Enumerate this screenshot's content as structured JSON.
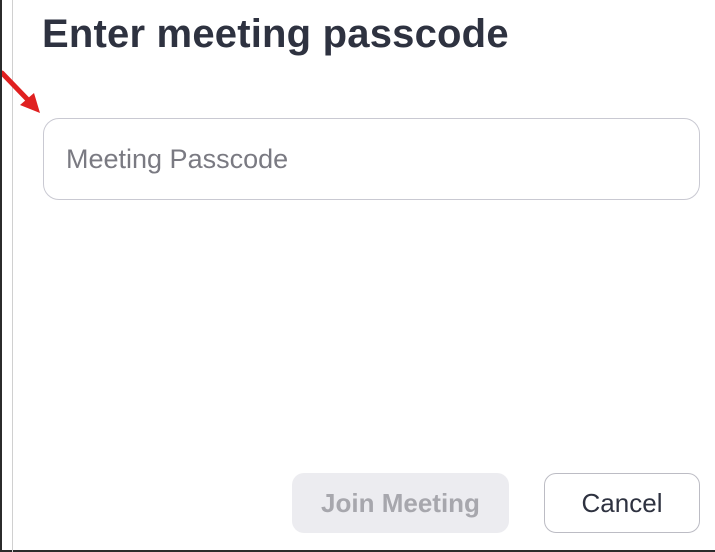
{
  "dialog": {
    "title": "Enter meeting passcode",
    "passcode_input": {
      "placeholder": "Meeting Passcode",
      "value": ""
    },
    "buttons": {
      "join_label": "Join Meeting",
      "join_enabled": false,
      "cancel_label": "Cancel"
    }
  },
  "annotation": {
    "arrow_color": "#e02020",
    "arrow_icon": "red-pointer-arrow-icon"
  },
  "colors": {
    "title_text": "#2e3240",
    "input_border": "#c9c9d2",
    "disabled_button_bg": "#ececf0",
    "disabled_button_text": "#a7a7ad"
  }
}
